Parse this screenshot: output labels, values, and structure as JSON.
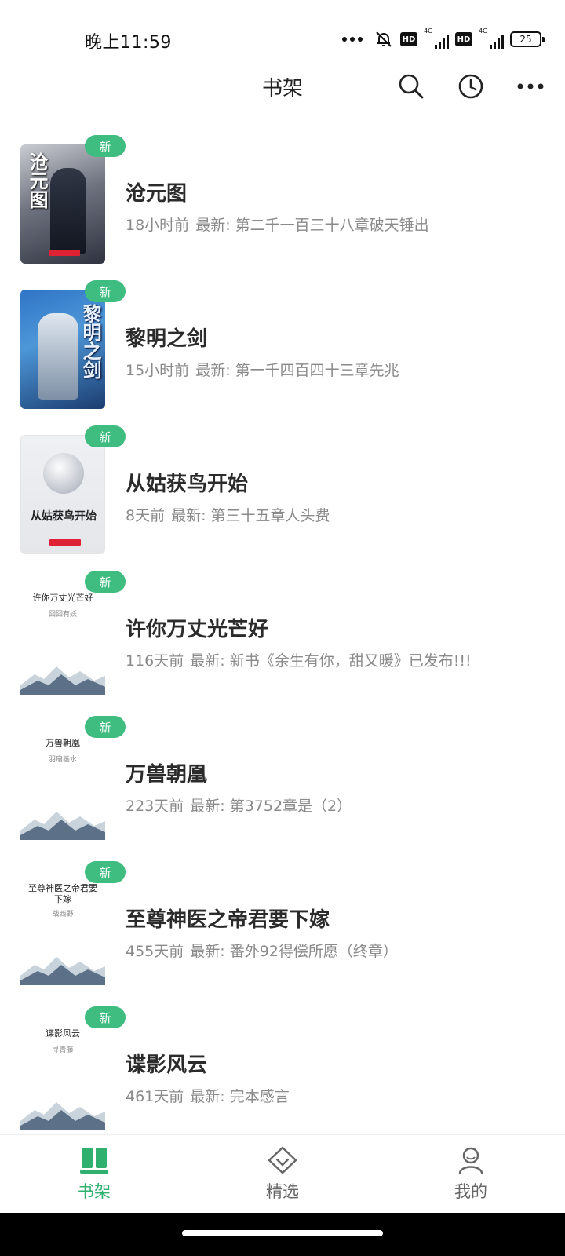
{
  "status_bar": {
    "time": "晚上11:59",
    "hd1": "HD",
    "net1": "4G",
    "hd2": "HD",
    "net2": "4G",
    "battery": "25"
  },
  "header": {
    "title": "书架",
    "actions": [
      "search-icon",
      "history-clock-icon",
      "more-icon"
    ]
  },
  "books": [
    {
      "title": "沧元图",
      "time": "18小时前",
      "latest": "最新: 第二千一百三十八章破天锤出",
      "badge": "新",
      "cover_title": "沧元图",
      "cover_style": "art1"
    },
    {
      "title": "黎明之剑",
      "time": "15小时前",
      "latest": "最新: 第一千四百四十三章先兆",
      "badge": "新",
      "cover_title": "黎明之剑",
      "cover_style": "art2"
    },
    {
      "title": "从姑获鸟开始",
      "time": "8天前",
      "latest": "最新: 第三十五章人头费",
      "badge": "新",
      "cover_title": "从姑获鸟开始",
      "cover_style": "art3"
    },
    {
      "title": "许你万丈光芒好",
      "time": "116天前",
      "latest": "最新: 新书《余生有你，甜又暖》已发布!!!",
      "badge": "新",
      "cover_title": "许你万丈光芒好",
      "cover_author": "囧囧有妖",
      "cover_style": "plain"
    },
    {
      "title": "万兽朝凰",
      "time": "223天前",
      "latest": "最新: 第3752章是（2）",
      "badge": "新",
      "cover_title": "万兽朝凰",
      "cover_author": "羽扇画水",
      "cover_style": "plain"
    },
    {
      "title": "至尊神医之帝君要下嫁",
      "time": "455天前",
      "latest": "最新: 番外92得偿所愿（终章）",
      "badge": "新",
      "cover_title": "至尊神医之帝君要下嫁",
      "cover_author": "战西野",
      "cover_style": "plain"
    },
    {
      "title": "谍影风云",
      "time": "461天前",
      "latest": "最新: 完本感言",
      "badge": "新",
      "cover_title": "谍影风云",
      "cover_author": "寻青藤",
      "cover_style": "plain"
    }
  ],
  "bottom_nav": {
    "items": [
      {
        "label": "书架",
        "icon": "bookshelf-icon",
        "active": true
      },
      {
        "label": "精选",
        "icon": "diamond-icon",
        "active": false
      },
      {
        "label": "我的",
        "icon": "user-icon",
        "active": false
      }
    ]
  },
  "colors": {
    "accent": "#3fbc7f",
    "active_nav": "#2fb06f",
    "meta_text": "#8a8a8a"
  }
}
